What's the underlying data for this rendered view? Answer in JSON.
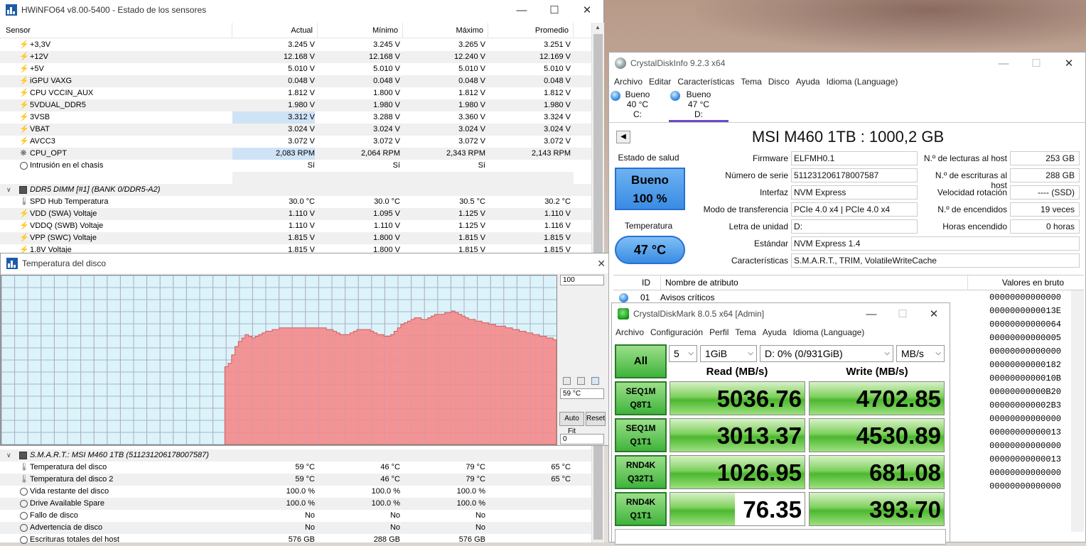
{
  "hwinfo": {
    "title": "HWiNFO64 v8.00-5400 - Estado de los sensores",
    "columns": [
      "Sensor",
      "Actual",
      "Mínimo",
      "Máximo",
      "Promedio"
    ],
    "rows_top": [
      {
        "icon": "bolt",
        "name": "+3,3V",
        "cur": "3.245 V",
        "min": "3.245 V",
        "max": "3.265 V",
        "avg": "3.251 V"
      },
      {
        "icon": "bolt",
        "name": "+12V",
        "cur": "12.168 V",
        "min": "12.168 V",
        "max": "12.240 V",
        "avg": "12.169 V"
      },
      {
        "icon": "bolt",
        "name": "+5V",
        "cur": "5.010 V",
        "min": "5.010 V",
        "max": "5.010 V",
        "avg": "5.010 V"
      },
      {
        "icon": "bolt",
        "name": "iGPU VAXG",
        "cur": "0.048 V",
        "min": "0.048 V",
        "max": "0.048 V",
        "avg": "0.048 V"
      },
      {
        "icon": "bolt",
        "name": "CPU VCCIN_AUX",
        "cur": "1.812 V",
        "min": "1.800 V",
        "max": "1.812 V",
        "avg": "1.812 V"
      },
      {
        "icon": "bolt",
        "name": "5VDUAL_DDR5",
        "cur": "1.980 V",
        "min": "1.980 V",
        "max": "1.980 V",
        "avg": "1.980 V"
      },
      {
        "icon": "bolt",
        "name": "3VSB",
        "cur": "3.312 V",
        "min": "3.288 V",
        "max": "3.360 V",
        "avg": "3.324 V",
        "hl": true
      },
      {
        "icon": "bolt",
        "name": "VBAT",
        "cur": "3.024 V",
        "min": "3.024 V",
        "max": "3.024 V",
        "avg": "3.024 V"
      },
      {
        "icon": "bolt",
        "name": "AVCC3",
        "cur": "3.072 V",
        "min": "3.072 V",
        "max": "3.072 V",
        "avg": "3.072 V"
      },
      {
        "icon": "fan",
        "name": "CPU_OPT",
        "cur": "2,083 RPM",
        "min": "2,064 RPM",
        "max": "2,343 RPM",
        "avg": "2,143 RPM",
        "hl": true
      },
      {
        "icon": "circle",
        "name": "Intrusión en el chasis",
        "cur": "Sí",
        "min": "Sí",
        "max": "Sí",
        "avg": ""
      }
    ],
    "group_ddr5": "DDR5 DIMM [#1] (BANK 0/DDR5-A2)",
    "rows_ddr5": [
      {
        "icon": "thermo",
        "name": "SPD Hub Temperatura",
        "cur": "30.0 °C",
        "min": "30.0 °C",
        "max": "30.5 °C",
        "avg": "30.2 °C"
      },
      {
        "icon": "bolt",
        "name": "VDD (SWA) Voltaje",
        "cur": "1.110 V",
        "min": "1.095 V",
        "max": "1.125 V",
        "avg": "1.110 V"
      },
      {
        "icon": "bolt",
        "name": "VDDQ (SWB) Voltaje",
        "cur": "1.110 V",
        "min": "1.110 V",
        "max": "1.125 V",
        "avg": "1.116 V"
      },
      {
        "icon": "bolt",
        "name": "VPP (SWC) Voltaje",
        "cur": "1.815 V",
        "min": "1.800 V",
        "max": "1.815 V",
        "avg": "1.815 V"
      },
      {
        "icon": "bolt",
        "name": "1.8V Voltaje",
        "cur": "1.815 V",
        "min": "1.800 V",
        "max": "1.815 V",
        "avg": "1.815 V"
      }
    ],
    "group_smart": "S.M.A.R.T.: MSI M460 1TB (511231206178007587)",
    "rows_smart": [
      {
        "icon": "thermo",
        "name": "Temperatura del disco",
        "cur": "59 °C",
        "min": "46 °C",
        "max": "79 °C",
        "avg": "65 °C"
      },
      {
        "icon": "thermo",
        "name": "Temperatura del disco 2",
        "cur": "59 °C",
        "min": "46 °C",
        "max": "79 °C",
        "avg": "65 °C"
      },
      {
        "icon": "circle",
        "name": "Vida restante del disco",
        "cur": "100.0 %",
        "min": "100.0 %",
        "max": "100.0 %",
        "avg": ""
      },
      {
        "icon": "circle",
        "name": "Drive Available Spare",
        "cur": "100.0 %",
        "min": "100.0 %",
        "max": "100.0 %",
        "avg": ""
      },
      {
        "icon": "circle",
        "name": "Fallo de disco",
        "cur": "No",
        "min": "No",
        "max": "No",
        "avg": ""
      },
      {
        "icon": "circle",
        "name": "Advertencia de disco",
        "cur": "No",
        "min": "No",
        "max": "No",
        "avg": ""
      },
      {
        "icon": "circle",
        "name": "Escrituras totales del host",
        "cur": "576 GB",
        "min": "288 GB",
        "max": "576 GB",
        "avg": ""
      }
    ]
  },
  "temp_graph": {
    "title": "Temperatura del disco",
    "max_label": "100",
    "current_label": "59 °C",
    "min_label": "0",
    "auto_fit": "Auto Fit",
    "reset": "Reset",
    "fill_color": "#f4898a",
    "grid_color": "#9fb7cf",
    "series": [
      null,
      null,
      null,
      null,
      null,
      null,
      null,
      null,
      null,
      null,
      null,
      null,
      null,
      null,
      null,
      null,
      null,
      null,
      null,
      null,
      null,
      null,
      null,
      null,
      null,
      null,
      null,
      null,
      null,
      null,
      null,
      null,
      null,
      null,
      null,
      null,
      null,
      null,
      null,
      null,
      null,
      null,
      null,
      null,
      null,
      null,
      null,
      null,
      null,
      null,
      null,
      null,
      null,
      null,
      null,
      null,
      null,
      null,
      null,
      null,
      null,
      null,
      null,
      null,
      null,
      null,
      46,
      48,
      53,
      58,
      61,
      63,
      65,
      64,
      63,
      64,
      65,
      66,
      67,
      67,
      68,
      68,
      69,
      69,
      69,
      69,
      69,
      69,
      69,
      69,
      69,
      69,
      69,
      69,
      69,
      69,
      68,
      68,
      67,
      66,
      65,
      65,
      65,
      66,
      67,
      68,
      68,
      68,
      68,
      67,
      66,
      65,
      65,
      64,
      64,
      65,
      67,
      69,
      71,
      72,
      73,
      74,
      75,
      75,
      74,
      74,
      75,
      76,
      77,
      77,
      77,
      78,
      78,
      79,
      78,
      77,
      76,
      75,
      74,
      74,
      73,
      73,
      72,
      72,
      71,
      71,
      70,
      70,
      70,
      69,
      69,
      68,
      68,
      67,
      67,
      66,
      66,
      65,
      65,
      64,
      64,
      63,
      63,
      62
    ]
  },
  "cdi": {
    "title": "CrystalDiskInfo 9.2.3 x64",
    "menu": [
      "Archivo",
      "Editar",
      "Características",
      "Tema",
      "Disco",
      "Ayuda",
      "Idioma (Language)"
    ],
    "drives": [
      {
        "status": "Bueno",
        "temp": "40 °C",
        "letter": "C:"
      },
      {
        "status": "Bueno",
        "temp": "47 °C",
        "letter": "D:"
      }
    ],
    "model": "MSI M460 1TB : 1000,2 GB",
    "health_label": "Estado de salud",
    "health_status": "Bueno",
    "health_percent": "100 %",
    "temp_label": "Temperatura",
    "temp_value": "47 °C",
    "fields_left": [
      {
        "label": "Firmware",
        "value": "ELFMH0.1"
      },
      {
        "label": "Número de serie",
        "value": "511231206178007587"
      },
      {
        "label": "Interfaz",
        "value": "NVM Express"
      },
      {
        "label": "Modo de transferencia",
        "value": "PCIe 4.0 x4 | PCIe 4.0 x4"
      },
      {
        "label": "Letra de unidad",
        "value": "D:"
      }
    ],
    "fields_right": [
      {
        "label": "N.º de lecturas al host",
        "value": "253 GB"
      },
      {
        "label": "N.º de escrituras al host",
        "value": "288 GB"
      },
      {
        "label": "Velocidad rotación",
        "value": "---- (SSD)"
      },
      {
        "label": "N.º de encendidos",
        "value": "19 veces"
      },
      {
        "label": "Horas encendido",
        "value": "0 horas"
      }
    ],
    "standard_label": "Estándar",
    "standard_value": "NVM Express 1.4",
    "features_label": "Características",
    "features_value": "S.M.A.R.T., TRIM, VolatileWriteCache",
    "attr_headers": {
      "id": "ID",
      "name": "Nombre de atributo",
      "raw": "Valores en bruto"
    },
    "attributes": [
      {
        "id": "01",
        "name": "Avisos críticos",
        "raw": "00000000000000"
      },
      {
        "id": "",
        "name": "",
        "raw": "0000000000013E"
      },
      {
        "id": "",
        "name": "",
        "raw": "00000000000064"
      },
      {
        "id": "",
        "name": "",
        "raw": "00000000000005"
      },
      {
        "id": "",
        "name": "",
        "raw": "00000000000000"
      },
      {
        "id": "",
        "name": "",
        "raw": "00000000000182"
      },
      {
        "id": "",
        "name": "",
        "raw": "0000000000010B"
      },
      {
        "id": "",
        "name": "",
        "raw": "00000000000B20"
      },
      {
        "id": "",
        "name": "",
        "raw": "000000000002B3"
      },
      {
        "id": "",
        "name": "",
        "raw": "00000000000000"
      },
      {
        "id": "",
        "name": "",
        "raw": "00000000000013"
      },
      {
        "id": "",
        "name": "",
        "raw": "00000000000000"
      },
      {
        "id": "",
        "name": "",
        "raw": "00000000000013"
      },
      {
        "id": "",
        "name": "",
        "raw": "00000000000000"
      },
      {
        "id": "",
        "name": "",
        "raw": "00000000000000"
      }
    ]
  },
  "cdm": {
    "title": "CrystalDiskMark 8.0.5 x64 [Admin]",
    "menu": [
      "Archivo",
      "Configuración",
      "Perfil",
      "Tema",
      "Ayuda",
      "Idioma (Language)"
    ],
    "all_label": "All",
    "count": "5",
    "size": "1GiB",
    "drive": "D: 0% (0/931GiB)",
    "unit": "MB/s",
    "read_header": "Read (MB/s)",
    "write_header": "Write (MB/s)",
    "tests": [
      {
        "line1": "SEQ1M",
        "line2": "Q8T1",
        "read": "5036.76",
        "write": "4702.85",
        "read_fill": 1.0,
        "write_fill": 1.0
      },
      {
        "line1": "SEQ1M",
        "line2": "Q1T1",
        "read": "3013.37",
        "write": "4530.89",
        "read_fill": 1.0,
        "write_fill": 1.0
      },
      {
        "line1": "RND4K",
        "line2": "Q32T1",
        "read": "1026.95",
        "write": "681.08",
        "read_fill": 1.0,
        "write_fill": 1.0
      },
      {
        "line1": "RND4K",
        "line2": "Q1T1",
        "read": "76.35",
        "write": "393.70",
        "read_fill": 0.48,
        "write_fill": 1.0
      }
    ]
  }
}
